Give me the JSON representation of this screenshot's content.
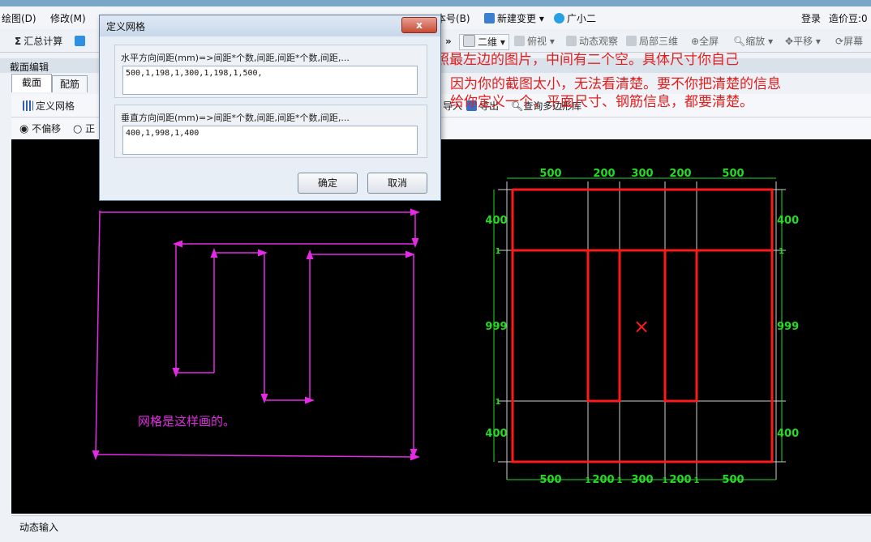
{
  "menu": {
    "items": [
      "绘图(D)",
      "修改(M)",
      "本号(B)",
      "新建变更",
      "广小二",
      "登录",
      "造价豆:0"
    ]
  },
  "toolbar": {
    "items": [
      "汇总计算",
      "二维",
      "俯视",
      "动态观察",
      "局部三维",
      "全屏",
      "缩放",
      "平移",
      "屏幕"
    ],
    "extra": [
      "导入",
      "导出",
      "查询多边形库"
    ]
  },
  "panel": {
    "title": "截面编辑",
    "tabs": [
      "截面",
      "配筋"
    ],
    "define_grid_label": "定义网格",
    "radio": [
      "不偏移",
      "正"
    ],
    "status": "动态输入"
  },
  "dialog": {
    "title": "定义网格",
    "close": "x",
    "h_label": "水平方向间距(mm)=>间距*个数,间距,间距*个数,间距,...",
    "h_value": "500,1,198,1,300,1,198,1,500,",
    "v_label": "垂直方向间距(mm)=>间距*个数,间距,间距*个数,间距,...",
    "v_value": "400,1,998,1,400",
    "ok": "确定",
    "cancel": "取消"
  },
  "annotation": {
    "line1": "这是仿照最左边的图片，中间有二个空。具体尺寸你自己",
    "line2": "设置。因为你的截图太小，无法看清楚。要不你把清楚的信息",
    "line3": "上传，给你定义一个，平面尺寸、钢筋信息，都要清楚。",
    "grid_note": "网格是这样画的。"
  },
  "drawing": {
    "top_dims": [
      "500",
      "200",
      "300",
      "200",
      "500"
    ],
    "bottom_dims": [
      "500",
      "1",
      "200",
      "1",
      "300",
      "1",
      "200",
      "1",
      "500"
    ],
    "left_dims": [
      "400",
      "1",
      "999",
      "1",
      "400"
    ],
    "right_dims": [
      "400",
      "1",
      "999",
      "400"
    ],
    "cross": "×"
  },
  "colors": {
    "magenta": "#e22be2",
    "green": "#22dd22",
    "red": "#ff1a1a",
    "note_red": "#e31e1e"
  }
}
